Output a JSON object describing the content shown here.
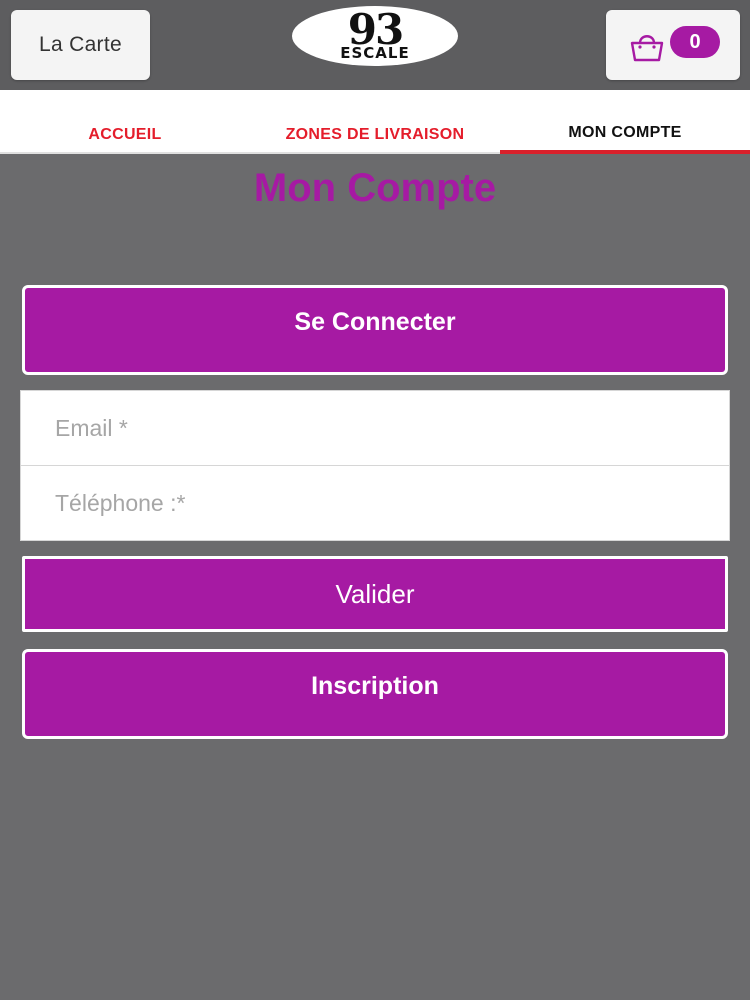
{
  "header": {
    "menu_label": "La Carte",
    "logo_number": "93",
    "logo_word": "ESCALE",
    "cart_count": "0",
    "cart_icon": "shopping-bag-icon"
  },
  "tabs": [
    {
      "label": "ACCUEIL",
      "active": false
    },
    {
      "label": "ZONES DE LIVRAISON",
      "active": false
    },
    {
      "label": "MON COMPTE",
      "active": true
    }
  ],
  "page": {
    "title": "Mon Compte",
    "login_label": "Se Connecter",
    "email_placeholder": "Email *",
    "phone_placeholder": "Téléphone :*",
    "validate_label": "Valider",
    "signup_label": "Inscription"
  },
  "colors": {
    "accent": "#a61aa3",
    "tab_inactive": "#e41d2b",
    "tab_indicator": "#d9202b",
    "background": "#6b6b6d",
    "header": "#5d5d5f"
  }
}
